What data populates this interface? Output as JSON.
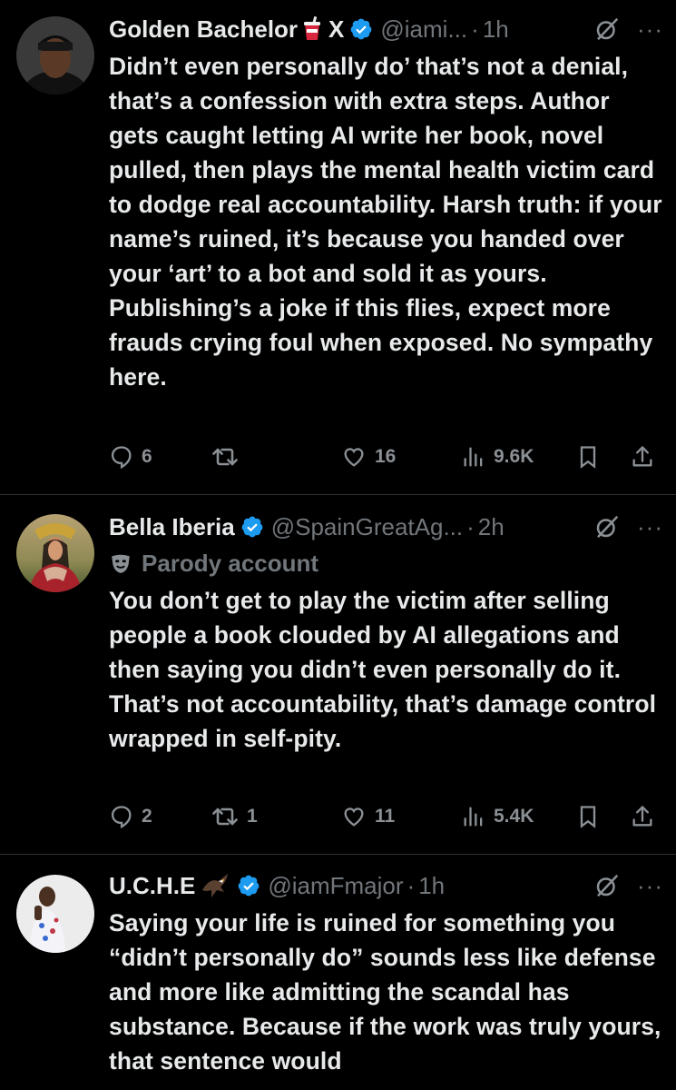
{
  "tweets": [
    {
      "name": "Golden Bachelor",
      "name_extra": "X",
      "handle": "@iami...",
      "time": "1h",
      "text": "Didn’t even personally do’ that’s not a denial, that’s a confession with extra steps. Author gets caught letting AI write her book, novel pulled, then plays the mental health victim card to dodge real accountability. Harsh truth: if your name’s ruined, it’s because you handed over your ‘art’ to a bot and sold it as yours. Publishing’s a joke if this flies, expect more frauds crying foul when exposed. No sympathy here.",
      "replies": "6",
      "reposts": "",
      "likes": "16",
      "views": "9.6K"
    },
    {
      "name": "Bella Iberia",
      "handle": "@SpainGreatAg...",
      "time": "2h",
      "label": "Parody account",
      "text": "You don’t get to play the victim after selling people a book clouded by AI allegations and then saying you didn’t even personally do it. That’s not accountability, that’s damage control wrapped in self-pity.",
      "replies": "2",
      "reposts": "1",
      "likes": "11",
      "views": "5.4K"
    },
    {
      "name": "U.C.H.E",
      "handle": "@iamFmajor",
      "time": "1h",
      "text": "Saying your life is ruined for something you “didn’t personally do” sounds less like defense and more like admitting the scandal has substance. Because if the work was truly yours, that sentence would"
    }
  ],
  "dot": "·",
  "colors": {
    "verified": "#1d9bf0",
    "muted": "#71767b",
    "text": "#e7e9ea",
    "divider": "#2f3336"
  }
}
